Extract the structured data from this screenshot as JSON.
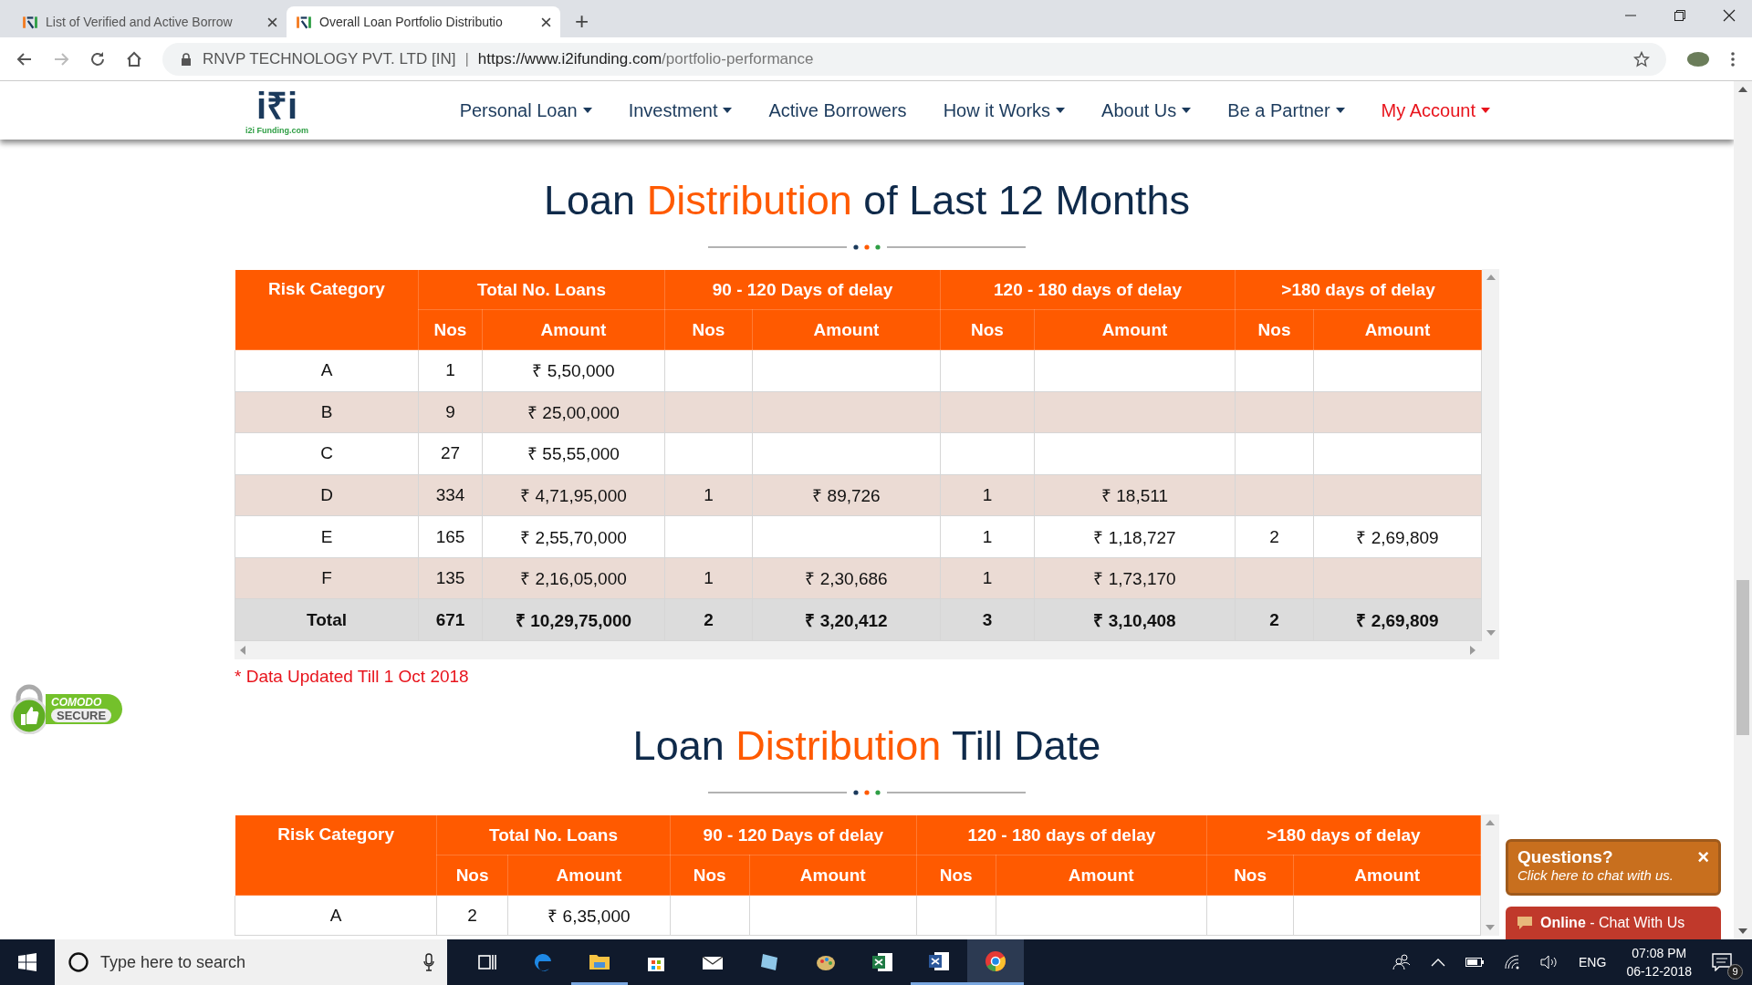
{
  "browser": {
    "tabs": [
      {
        "title": "List of Verified and Active Borrow",
        "selected": false
      },
      {
        "title": "Overall Loan Portfolio Distributio",
        "selected": true
      }
    ],
    "new_tab": "+",
    "site_identity": "RNVP TECHNOLOGY PVT. LTD [IN]",
    "separator": "|",
    "url_host": "https://www.i2ifunding.com",
    "url_path": "/portfolio-performance"
  },
  "logo": {
    "mark": "i₹i",
    "caption": "i2i Funding.com"
  },
  "nav": [
    {
      "label": "Personal Loan",
      "dropdown": true,
      "active": false
    },
    {
      "label": "Investment",
      "dropdown": true,
      "active": false
    },
    {
      "label": "Active Borrowers",
      "dropdown": false,
      "active": false
    },
    {
      "label": "How it Works",
      "dropdown": true,
      "active": false
    },
    {
      "label": "About Us",
      "dropdown": true,
      "active": false
    },
    {
      "label": "Be a Partner",
      "dropdown": true,
      "active": false
    },
    {
      "label": "My Account",
      "dropdown": true,
      "active": true
    }
  ],
  "sections": [
    {
      "title": {
        "before": "Loan",
        "highlight": "Distribution",
        "after": "of Last 12 Months"
      },
      "table": {
        "groups": [
          "Risk Category",
          "Total No. Loans",
          "90 - 120 Days of delay",
          "120 - 180 days of delay",
          ">180 days of delay"
        ],
        "subheaders": [
          "Nos",
          "Amount",
          "Nos",
          "Amount",
          "Nos",
          "Amount",
          "Nos",
          "Amount"
        ],
        "rows": [
          {
            "kind": "data",
            "cells": [
              "A",
              "1",
              "₹ 5,50,000",
              "",
              "",
              "",
              "",
              "",
              ""
            ]
          },
          {
            "kind": "data",
            "cells": [
              "B",
              "9",
              "₹ 25,00,000",
              "",
              "",
              "",
              "",
              "",
              ""
            ]
          },
          {
            "kind": "data",
            "cells": [
              "C",
              "27",
              "₹ 55,55,000",
              "",
              "",
              "",
              "",
              "",
              ""
            ]
          },
          {
            "kind": "data",
            "cells": [
              "D",
              "334",
              "₹ 4,71,95,000",
              "1",
              "₹ 89,726",
              "1",
              "₹ 18,511",
              "",
              ""
            ]
          },
          {
            "kind": "data",
            "cells": [
              "E",
              "165",
              "₹ 2,55,70,000",
              "",
              "",
              "1",
              "₹ 1,18,727",
              "2",
              "₹ 2,69,809"
            ]
          },
          {
            "kind": "data",
            "cells": [
              "F",
              "135",
              "₹ 2,16,05,000",
              "1",
              "₹ 2,30,686",
              "1",
              "₹ 1,73,170",
              "",
              ""
            ]
          },
          {
            "kind": "total",
            "cells": [
              "Total",
              "671",
              "₹ 10,29,75,000",
              "2",
              "₹ 3,20,412",
              "3",
              "₹ 3,10,408",
              "2",
              "₹ 2,69,809"
            ]
          }
        ]
      },
      "note": "* Data Updated Till 1 Oct 2018"
    },
    {
      "title": {
        "before": "Loan",
        "highlight": "Distribution",
        "after": "Till Date"
      },
      "table": {
        "groups": [
          "Risk Category",
          "Total No. Loans",
          "90 - 120 Days of delay",
          "120 - 180 days of delay",
          ">180 days of delay"
        ],
        "subheaders": [
          "Nos",
          "Amount",
          "Nos",
          "Amount",
          "Nos",
          "Amount",
          "Nos",
          "Amount"
        ],
        "rows": [
          {
            "kind": "data",
            "cells": [
              "A",
              "2",
              "₹ 6,35,000",
              "",
              "",
              "",
              "",
              "",
              ""
            ]
          }
        ]
      }
    }
  ],
  "badge": {
    "top": "COMODO",
    "bottom": "SECURE"
  },
  "chat": {
    "title": "Questions?",
    "close": "×",
    "subtitle": "Click here to chat with us.",
    "button": "**Online** - Chat With Us"
  },
  "taskbar": {
    "search_placeholder": "Type here to search",
    "apps": [
      {
        "kind": "taskview",
        "open": false,
        "selected": false
      },
      {
        "kind": "edge",
        "open": false,
        "selected": false
      },
      {
        "kind": "explorer",
        "open": true,
        "selected": false
      },
      {
        "kind": "store",
        "open": false,
        "selected": false
      },
      {
        "kind": "mail",
        "open": false,
        "selected": false
      },
      {
        "kind": "tablet",
        "open": false,
        "selected": false
      },
      {
        "kind": "paint",
        "open": false,
        "selected": false
      },
      {
        "kind": "excel",
        "open": false,
        "selected": false
      },
      {
        "kind": "word",
        "open": true,
        "selected": false
      },
      {
        "kind": "chrome",
        "open": true,
        "selected": true
      }
    ],
    "language": "ENG",
    "time": "07:08 PM",
    "date": "06-12-2018",
    "notifications": "9"
  }
}
